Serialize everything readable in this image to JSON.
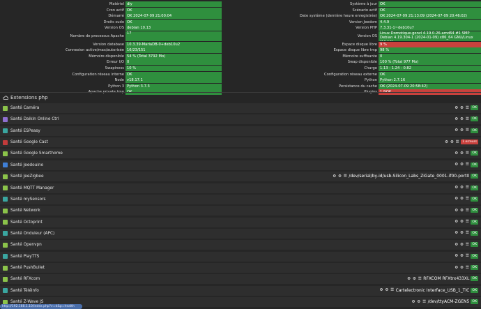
{
  "stats_left": [
    {
      "label": "Matériel",
      "value": "diy",
      "status": "ok"
    },
    {
      "label": "Cron actif",
      "value": "OK",
      "status": "ok"
    },
    {
      "label": "Démarré",
      "value": "OK 2024-07-09 21:00:04",
      "status": "ok"
    },
    {
      "label": "Droits sudo",
      "value": "OK",
      "status": "ok"
    },
    {
      "label": "Version OS",
      "value": "debian 10.13",
      "status": "ok"
    },
    {
      "label": "Nombre de processus Apache",
      "value": "17",
      "status": "ok",
      "tall": true
    },
    {
      "label": "Version database",
      "value": "10.3.39-MariaDB-0+deb10u2",
      "status": "ok"
    },
    {
      "label": "Connexion active/max/autorisée",
      "value": "16/23/151",
      "status": "ok"
    },
    {
      "label": "Mémoire disponible",
      "value": "54 % (Total 3792 Mo)",
      "status": "ok"
    },
    {
      "label": "Erreur I/O",
      "value": "0",
      "status": "ok"
    },
    {
      "label": "Swapiness",
      "value": "10 %",
      "status": "ok"
    },
    {
      "label": "Configuration réseau interne",
      "value": "OK",
      "status": "ok"
    },
    {
      "label": "Node",
      "value": "v18.17.1",
      "status": "ok"
    },
    {
      "label": "Python 3",
      "value": "Python 3.7.3",
      "status": "ok"
    },
    {
      "label": "Apache private tmp",
      "value": "OK",
      "status": "ok"
    }
  ],
  "stats_right": [
    {
      "label": "Système à jour",
      "value": "OK",
      "status": "ok"
    },
    {
      "label": "Scénario actif",
      "value": "OK",
      "status": "ok"
    },
    {
      "label": "Date système (dernière heure enregistrée)",
      "value": "OK 2024-07-09 21:13:09 (2024-07-09 20:46:02)",
      "status": "ok"
    },
    {
      "label": "Version Jeedom",
      "value": "4.4.9",
      "status": "ok"
    },
    {
      "label": "Version PHP",
      "value": "7.3.31-1~deb10u7",
      "status": "ok"
    },
    {
      "label": "Version OS",
      "value": "Linux Domotique-gonzl 4.19.0-26-amd64 #1 SMP Debian 4.19.304-1 (2024-01-09) x86_64 GNU/Linux [10.13]",
      "status": "ok",
      "tall": true
    },
    {
      "label": "Espace disque libre",
      "value": "9 %",
      "status": "warn"
    },
    {
      "label": "Espace disque libre tmp",
      "value": "98 %",
      "status": "ok"
    },
    {
      "label": "Mémoire suffisante",
      "value": "0",
      "status": "ok"
    },
    {
      "label": "Swap disponible",
      "value": "100 % (Total 977 Mo)",
      "status": "ok"
    },
    {
      "label": "Charge",
      "value": "1.13 - 1.24 - 0.82",
      "status": "ok"
    },
    {
      "label": "Configuration réseau externe",
      "value": "OK",
      "status": "ok"
    },
    {
      "label": "Python",
      "value": "Python 2.7.16",
      "status": "ok"
    },
    {
      "label": "Persistance du cache",
      "value": "OK (2024-07-09 20:58:42)",
      "status": "ok"
    },
    {
      "label": "Plugins",
      "value": "1 NOK",
      "status": "warn"
    }
  ],
  "section_title": "Extensions php",
  "colors": {
    "ok": "#2f8f3e",
    "error": "#c9413d",
    "row_bg": "#2e2e2e",
    "page_bg": "#262626"
  },
  "tools_glyphs": "⚙ ⚙ ☰",
  "extensions": [
    {
      "name": "Santé Caméra",
      "icon_color": "#8bc34a",
      "extra": "",
      "badge": "OK",
      "error": false
    },
    {
      "name": "Santé Daikin Online Ctrl",
      "icon_color": "#8f6fd1",
      "extra": "",
      "badge": "OK",
      "error": false
    },
    {
      "name": "Santé ESPeasy",
      "icon_color": "#3aa6a0",
      "extra": "",
      "badge": "OK",
      "error": false
    },
    {
      "name": "Santé Google Cast",
      "icon_color": "#c23b3b",
      "extra": "",
      "badge": "1 erreurs",
      "error": true
    },
    {
      "name": "Santé Google Smarthome",
      "icon_color": "#8bc34a",
      "extra": "",
      "badge": "OK",
      "error": false
    },
    {
      "name": "Santé Jeedouino",
      "icon_color": "#3f7fd6",
      "extra": "",
      "badge": "OK",
      "error": false
    },
    {
      "name": "Santé JeeZigbee",
      "icon_color": "#8bc34a",
      "extra": "/dev/serial/by-id/usb-Silicon_Labs_ZiGate_0001-if00-port0",
      "badge": "OK",
      "error": false
    },
    {
      "name": "Santé MQTT Manager",
      "icon_color": "#8bc34a",
      "extra": "",
      "badge": "OK",
      "error": false
    },
    {
      "name": "Santé mySensors",
      "icon_color": "#3aa6a0",
      "extra": "",
      "badge": "OK",
      "error": false
    },
    {
      "name": "Santé Network",
      "icon_color": "#8bc34a",
      "extra": "",
      "badge": "OK",
      "error": false
    },
    {
      "name": "Santé Octoprint",
      "icon_color": "#8bc34a",
      "extra": "",
      "badge": "OK",
      "error": false
    },
    {
      "name": "Santé Onduleur (APC)",
      "icon_color": "#3aa6a0",
      "extra": "",
      "badge": "OK",
      "error": false
    },
    {
      "name": "Santé Openvpn",
      "icon_color": "#8bc34a",
      "extra": "",
      "badge": "OK",
      "error": false
    },
    {
      "name": "Santé PlayTTS",
      "icon_color": "#3aa6a0",
      "extra": "",
      "badge": "OK",
      "error": false
    },
    {
      "name": "Santé PushBullet",
      "icon_color": "#8bc34a",
      "extra": "",
      "badge": "OK",
      "error": false
    },
    {
      "name": "Santé RFXcom",
      "icon_color": "#8bc34a",
      "extra": "RFXCOM RFXtrx433XL",
      "badge": "OK",
      "error": false
    },
    {
      "name": "Santé Téléinfo",
      "icon_color": "#3aa6a0",
      "extra": "Cartelectronic Interface_USB_1_TIC",
      "badge": "OK",
      "error": false
    },
    {
      "name": "Santé Z-Wave JS",
      "icon_color": "#8bc34a",
      "extra": "/dev/ttyACM-ZGEN5",
      "badge": "OK",
      "error": false
    }
  ],
  "tooltip": "http://192.168.1.10/index.php?v=d&p=health"
}
